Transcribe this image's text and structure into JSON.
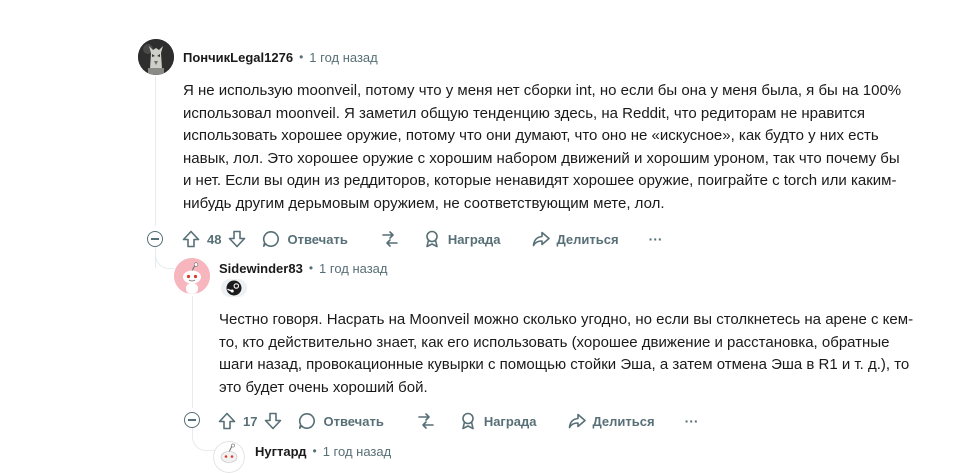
{
  "comments": [
    {
      "author": "ПончикLegal1276",
      "separator": "•",
      "time": "1 год назад",
      "avatar_icon": "werewolf-avatar-icon",
      "body_lines": [
        "Я не использую moonveil, потому что у меня нет сборки int, но если бы она у меня была, я бы на 100%",
        "использовал moonveil. Я заметил общую тенденцию здесь, на Reddit, что редиторам не нравится",
        "использовать хорошее оружие, потому что они думают, что оно не «искусное», как будто у них есть",
        "навык, лол. Это хорошее оружие с хорошим набором движений и хорошим уроном, так что почему бы",
        "и нет. Если вы один из реддиторов, которые ненавидят хорошее оружие, поиграйте с torch или каким-",
        "нибудь другим дерьмовым оружием, не соответствующим мете, лол."
      ],
      "votes": "48",
      "reply_label": "Отвечать",
      "award_label": "Награда",
      "share_label": "Делиться",
      "more_label": "···"
    },
    {
      "author": "Sidewinder83",
      "separator": "•",
      "time": "1 год назад",
      "avatar_icon": "snoo-avatar-icon",
      "flair_icon": "steam-icon",
      "body_lines": [
        "Честно говоря. Насрать на Moonveil можно сколько угодно, но если вы столкнетесь на арене с кем-",
        "то, кто действительно знает, как его использовать (хорошее движение и расстановка, обратные",
        "шаги назад, провокационные кувырки с помощью стойки Эша, а затем отмена Эша в R1 и т. д.), то",
        "это будет очень хороший бой."
      ],
      "votes": "17",
      "reply_label": "Отвечать",
      "award_label": "Награда",
      "share_label": "Делиться",
      "more_label": "···"
    },
    {
      "author": "Нугтард",
      "separator": "•",
      "time": "1 год назад",
      "avatar_icon": "snoo-avatar-icon"
    }
  ],
  "colors": {
    "text": "#1a1a1b",
    "muted": "#576f76",
    "thread_line": "#e5ebee",
    "snoo_pink_bg": "#f7b6be"
  }
}
